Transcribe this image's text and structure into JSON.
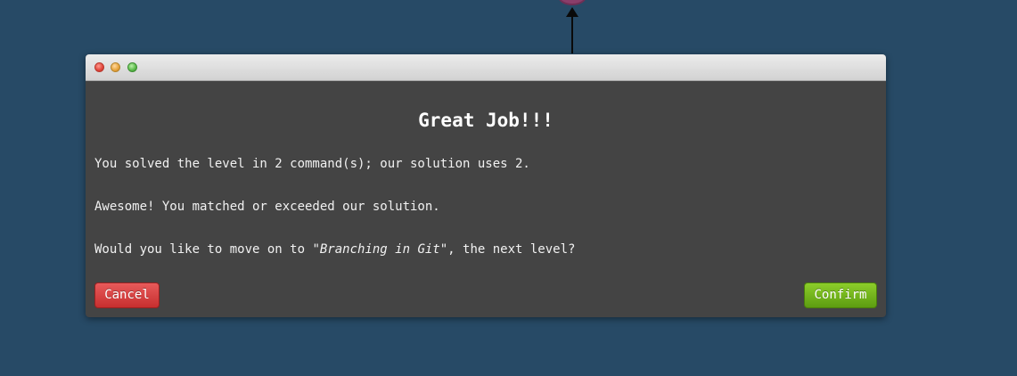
{
  "dialog": {
    "heading": "Great Job!!!",
    "line1": "You solved the level in 2 command(s); our solution uses 2.",
    "line2": "Awesome! You matched or exceeded our solution.",
    "line3_prefix": "Would you like to move on to ",
    "line3_level": "\"Branching in Git\"",
    "line3_suffix": ", the next level?",
    "cancel_label": "Cancel",
    "confirm_label": "Confirm"
  },
  "colors": {
    "background": "#274a66",
    "dialog_body": "#444444",
    "cancel": "#d64545",
    "confirm": "#74b51d"
  }
}
